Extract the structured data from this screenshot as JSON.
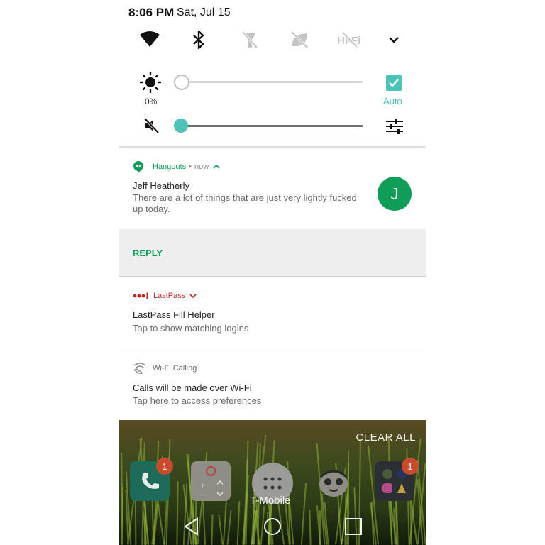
{
  "status": {
    "time": "8:06 PM",
    "date": "Sat, Jul 15"
  },
  "quick_settings": {
    "tiles": [
      "wifi-icon",
      "bluetooth-icon",
      "flashlight-off-icon",
      "battery-saver-off-icon",
      "hifi-off-icon",
      "expand-chevron-icon"
    ],
    "brightness_percent": "0%",
    "brightness_level": 0,
    "auto_brightness_checked": true,
    "auto_label": "Auto",
    "volume_level": 0,
    "accent": "#4cc3b6"
  },
  "notifications": {
    "hangouts": {
      "app": "Hangouts",
      "time": "now",
      "sender": "Jeff Heatherly",
      "message": "There are a lot of things that are just very lightly fucked up today.",
      "avatar_letter": "J",
      "reply_label": "REPLY",
      "color": "#0f9d58"
    },
    "lastpass": {
      "app": "LastPass",
      "title": "LastPass Fill Helper",
      "body": "Tap to show matching logins",
      "color": "#c62828"
    },
    "wifi_calling": {
      "app": "Wi-Fi Calling",
      "title": "Calls will be made over Wi-Fi",
      "body": "Tap here to access preferences"
    }
  },
  "home": {
    "clear_all_label": "CLEAR ALL",
    "carrier": "T-Mobile",
    "phone_badge": "1",
    "folder_badge": "1"
  },
  "navbar": [
    "back-icon",
    "home-icon",
    "recents-icon"
  ]
}
